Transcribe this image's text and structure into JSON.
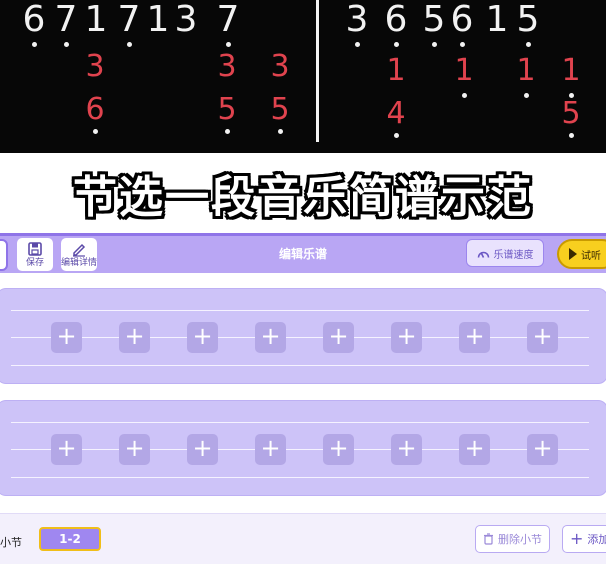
{
  "notation": {
    "left_melody": [
      "6",
      "7",
      "1",
      "7",
      "1",
      "3",
      "7"
    ],
    "left_harmony_top": [
      "3",
      "3",
      "3"
    ],
    "left_harmony_bottom": [
      "6",
      "5",
      "5"
    ],
    "right_melody": [
      "3",
      "6",
      "5",
      "6",
      "1",
      "5"
    ],
    "right_harmony_top": [
      "1",
      "1",
      "1",
      "1"
    ],
    "right_harmony_bottom": [
      "4",
      "5"
    ],
    "melody_color": "#f2f2f2",
    "harmony_color": "#e0434e"
  },
  "banner": {
    "title": "节选一段音乐简谱示范"
  },
  "toolbar": {
    "save_label": "保存",
    "edit_details_label": "编辑详情",
    "title": "编辑乐谱",
    "speed_label": "乐谱速度",
    "play_label": "试听"
  },
  "editor": {
    "staves": [
      {
        "cells": [
          "+",
          "+",
          "+",
          "+",
          "+",
          "+",
          "+",
          "+"
        ]
      },
      {
        "cells": [
          "+",
          "+",
          "+",
          "+",
          "+",
          "+",
          "+",
          "+"
        ]
      }
    ]
  },
  "bottom": {
    "section_label": "小节",
    "measure_range": "1-2",
    "delete_label": "删除小节",
    "add_label": "添加"
  },
  "colors": {
    "toolbar": "#b9a6f4",
    "staff": "#cdc3f8",
    "accent_yellow": "#f8cf1f"
  }
}
